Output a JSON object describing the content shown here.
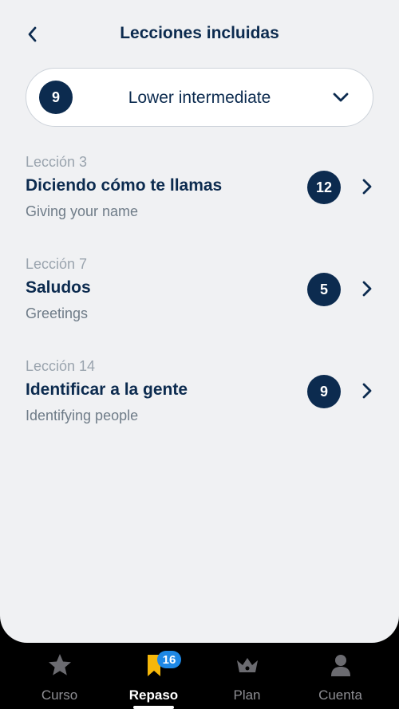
{
  "header": {
    "title": "Lecciones incluidas",
    "back_icon": "chevron-left-icon"
  },
  "level": {
    "number": "9",
    "name": "Lower intermediate",
    "dropdown_icon": "chevron-down-icon"
  },
  "lessons": [
    {
      "tag": "Lección 3",
      "title": "Diciendo cómo te llamas",
      "subtitle": "Giving your name",
      "count": "12"
    },
    {
      "tag": "Lección 7",
      "title": "Saludos",
      "subtitle": "Greetings",
      "count": "5"
    },
    {
      "tag": "Lección 14",
      "title": "Identificar a la gente",
      "subtitle": "Identifying people",
      "count": "9"
    }
  ],
  "tabbar": {
    "items": [
      {
        "label": "Curso",
        "icon": "star-icon",
        "active": false
      },
      {
        "label": "Repaso",
        "icon": "bookmark-icon",
        "active": true,
        "badge": "16"
      },
      {
        "label": "Plan",
        "icon": "crown-icon",
        "active": false
      },
      {
        "label": "Cuenta",
        "icon": "person-icon",
        "active": false
      }
    ]
  },
  "colors": {
    "navy": "#0c2b4f",
    "background": "#f0f1f3",
    "badge": "#1e88e5",
    "bookmark": "#f5b70a"
  }
}
